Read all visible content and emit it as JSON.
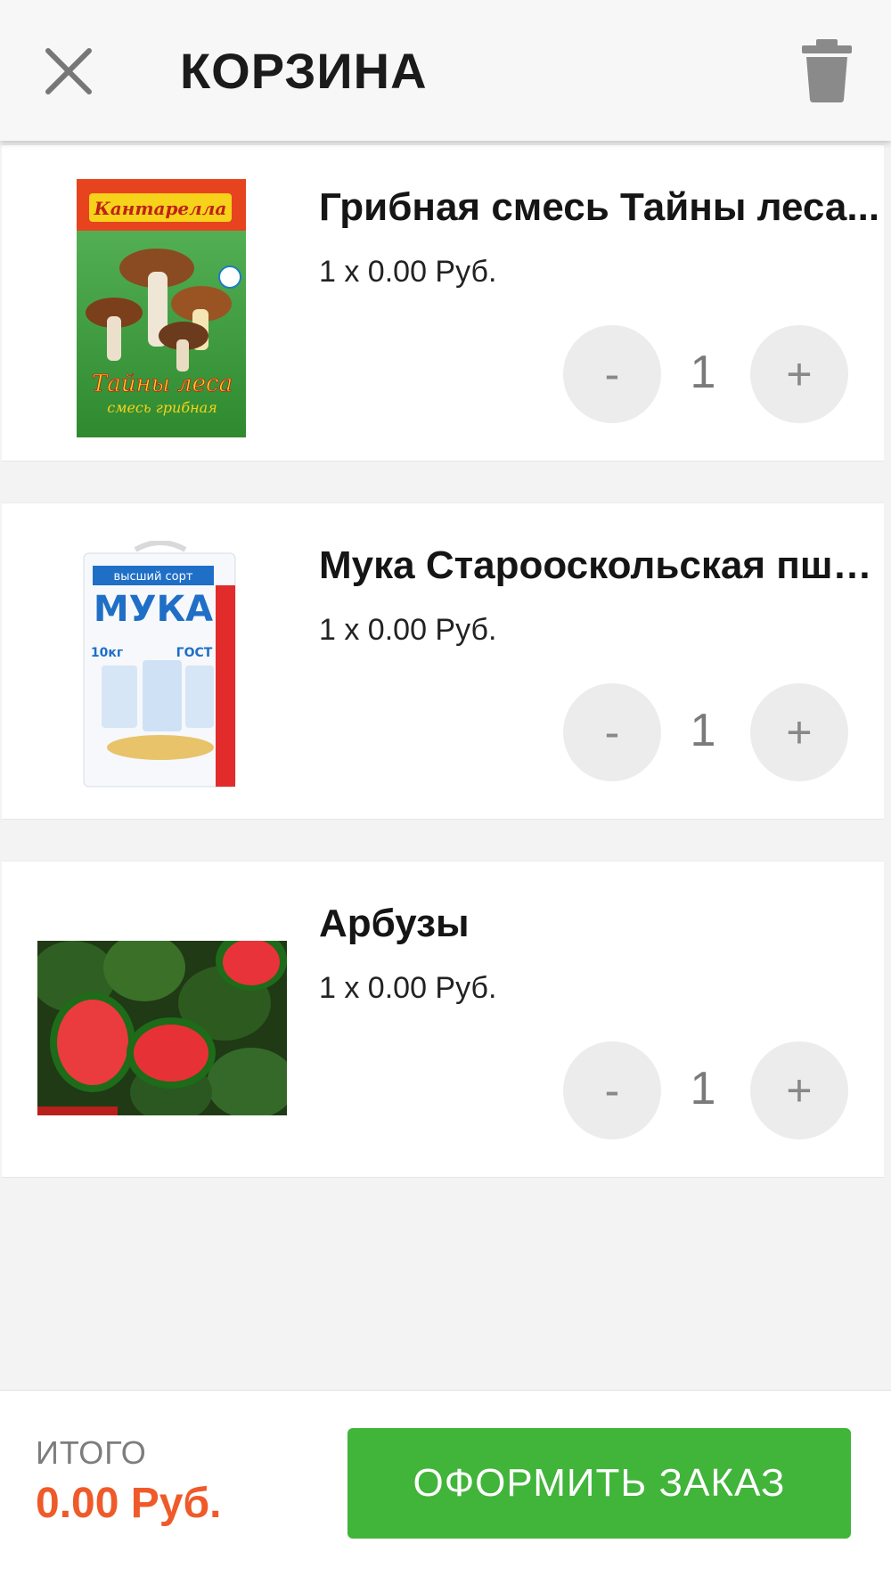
{
  "header": {
    "title": "КОРЗИНА",
    "close_icon": "close-icon",
    "trash_icon": "trash-icon"
  },
  "cart": {
    "items": [
      {
        "name": "Грибная смесь Тайны леса...",
        "price": "1 x 0.00 Руб.",
        "quantity": "1",
        "minus": "-",
        "plus": "+",
        "image": {
          "brand": "Кантарелла",
          "title": "Тайны леса",
          "subtitle": "смесь грибная"
        }
      },
      {
        "name": "Мука Старооскольская пше...",
        "price": "1 x 0.00 Руб.",
        "quantity": "1",
        "minus": "-",
        "plus": "+",
        "image": {
          "top_text": "высший сорт",
          "title": "МУКА",
          "weight": "10кг",
          "standard": "ГОСТ"
        }
      },
      {
        "name": "Арбузы",
        "price": "1 x 0.00 Руб.",
        "quantity": "1",
        "minus": "-",
        "plus": "+"
      }
    ]
  },
  "footer": {
    "total_label": "ИТОГО",
    "total_value": "0.00 Руб.",
    "checkout_label": "ОФОРМИТЬ ЗАКАЗ"
  },
  "colors": {
    "accent_green": "#41b43a",
    "total_orange": "#ef5a2a",
    "qty_button_bg": "#ececec"
  }
}
